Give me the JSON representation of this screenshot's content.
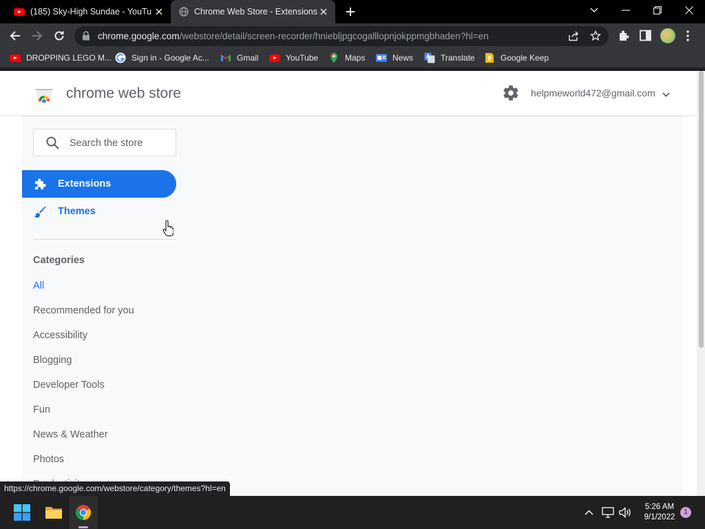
{
  "browser": {
    "tabs": [
      {
        "title": "(185) Sky-High Sundae - YouTube",
        "active": false,
        "favicon": "youtube-icon"
      },
      {
        "title": "Chrome Web Store - Extensions",
        "active": true,
        "favicon": "globe-icon"
      }
    ],
    "url_host": "chrome.google.com",
    "url_path": "/webstore/detail/screen-recorder/hniebljpgcogalllopnjokppmgbhaden?hl=en",
    "bookmarks": [
      {
        "label": "DROPPING LEGO M...",
        "icon": "youtube-icon"
      },
      {
        "label": "Sign in - Google Ac...",
        "icon": "google-icon"
      },
      {
        "label": "Gmail",
        "icon": "gmail-icon"
      },
      {
        "label": "YouTube",
        "icon": "youtube-icon"
      },
      {
        "label": "Maps",
        "icon": "maps-icon"
      },
      {
        "label": "News",
        "icon": "news-icon"
      },
      {
        "label": "Translate",
        "icon": "translate-icon"
      },
      {
        "label": "Google Keep",
        "icon": "keep-icon"
      }
    ],
    "status_url": "https://chrome.google.com/webstore/category/themes?hl=en"
  },
  "store": {
    "name": "chrome web store",
    "account": "helpmeworld472@gmail.com",
    "search_placeholder": "Search the store",
    "nav": {
      "extensions": "Extensions",
      "themes": "Themes"
    },
    "categories_heading": "Categories",
    "categories": [
      "All",
      "Recommended for you",
      "Accessibility",
      "Blogging",
      "Developer Tools",
      "Fun",
      "News & Weather",
      "Photos",
      "Productivity"
    ]
  },
  "taskbar": {
    "time": "5:26 AM",
    "date": "9/1/2022",
    "notification_count": "1"
  },
  "colors": {
    "accent": "#1a73e8",
    "titlebar": "#000000",
    "toolbar": "#35363a",
    "sidebar": "#f8f9fa"
  }
}
